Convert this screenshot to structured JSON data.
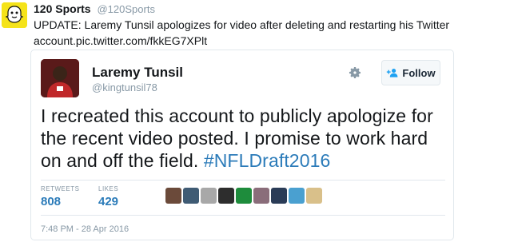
{
  "outer_tweet": {
    "name": "120 Sports",
    "handle": "@120Sports",
    "text": "UPDATE: Laremy Tunsil apologizes for video after deleting and restarting his Twitter account.pic.twitter.com/fkkEG7XPlt"
  },
  "embedded_tweet": {
    "name": "Laremy Tunsil",
    "handle": "@kingtunsil78",
    "follow_label": "Follow",
    "text_before_hashtag": "I recreated this account to publicly apologize for the recent video posted. I promise to work hard on and off the field. ",
    "hashtag": "#NFLDraft2016",
    "stats": {
      "retweets_label": "RETWEETS",
      "retweets_value": "808",
      "likes_label": "LIKES",
      "likes_value": "429"
    },
    "likers": [
      {
        "icon": "liker-avatar-1",
        "color": "#6b4a3a"
      },
      {
        "icon": "liker-avatar-2",
        "color": "#3f5b74"
      },
      {
        "icon": "liker-avatar-3",
        "color": "#a8a8a8"
      },
      {
        "icon": "liker-avatar-4",
        "color": "#2d2d2d"
      },
      {
        "icon": "liker-avatar-5",
        "color": "#1e8c3c"
      },
      {
        "icon": "liker-avatar-6",
        "color": "#8a6d7a"
      },
      {
        "icon": "liker-avatar-7",
        "color": "#2a3c57"
      },
      {
        "icon": "liker-avatar-8",
        "color": "#4aa0d0"
      },
      {
        "icon": "liker-avatar-9",
        "color": "#d9c08a"
      }
    ],
    "timestamp": "7:48 PM - 28 Apr 2016"
  },
  "colors": {
    "link_blue": "#2b7bb9",
    "secondary_gray": "#8899a6",
    "snapchat_yellow": "#f5e31a"
  }
}
